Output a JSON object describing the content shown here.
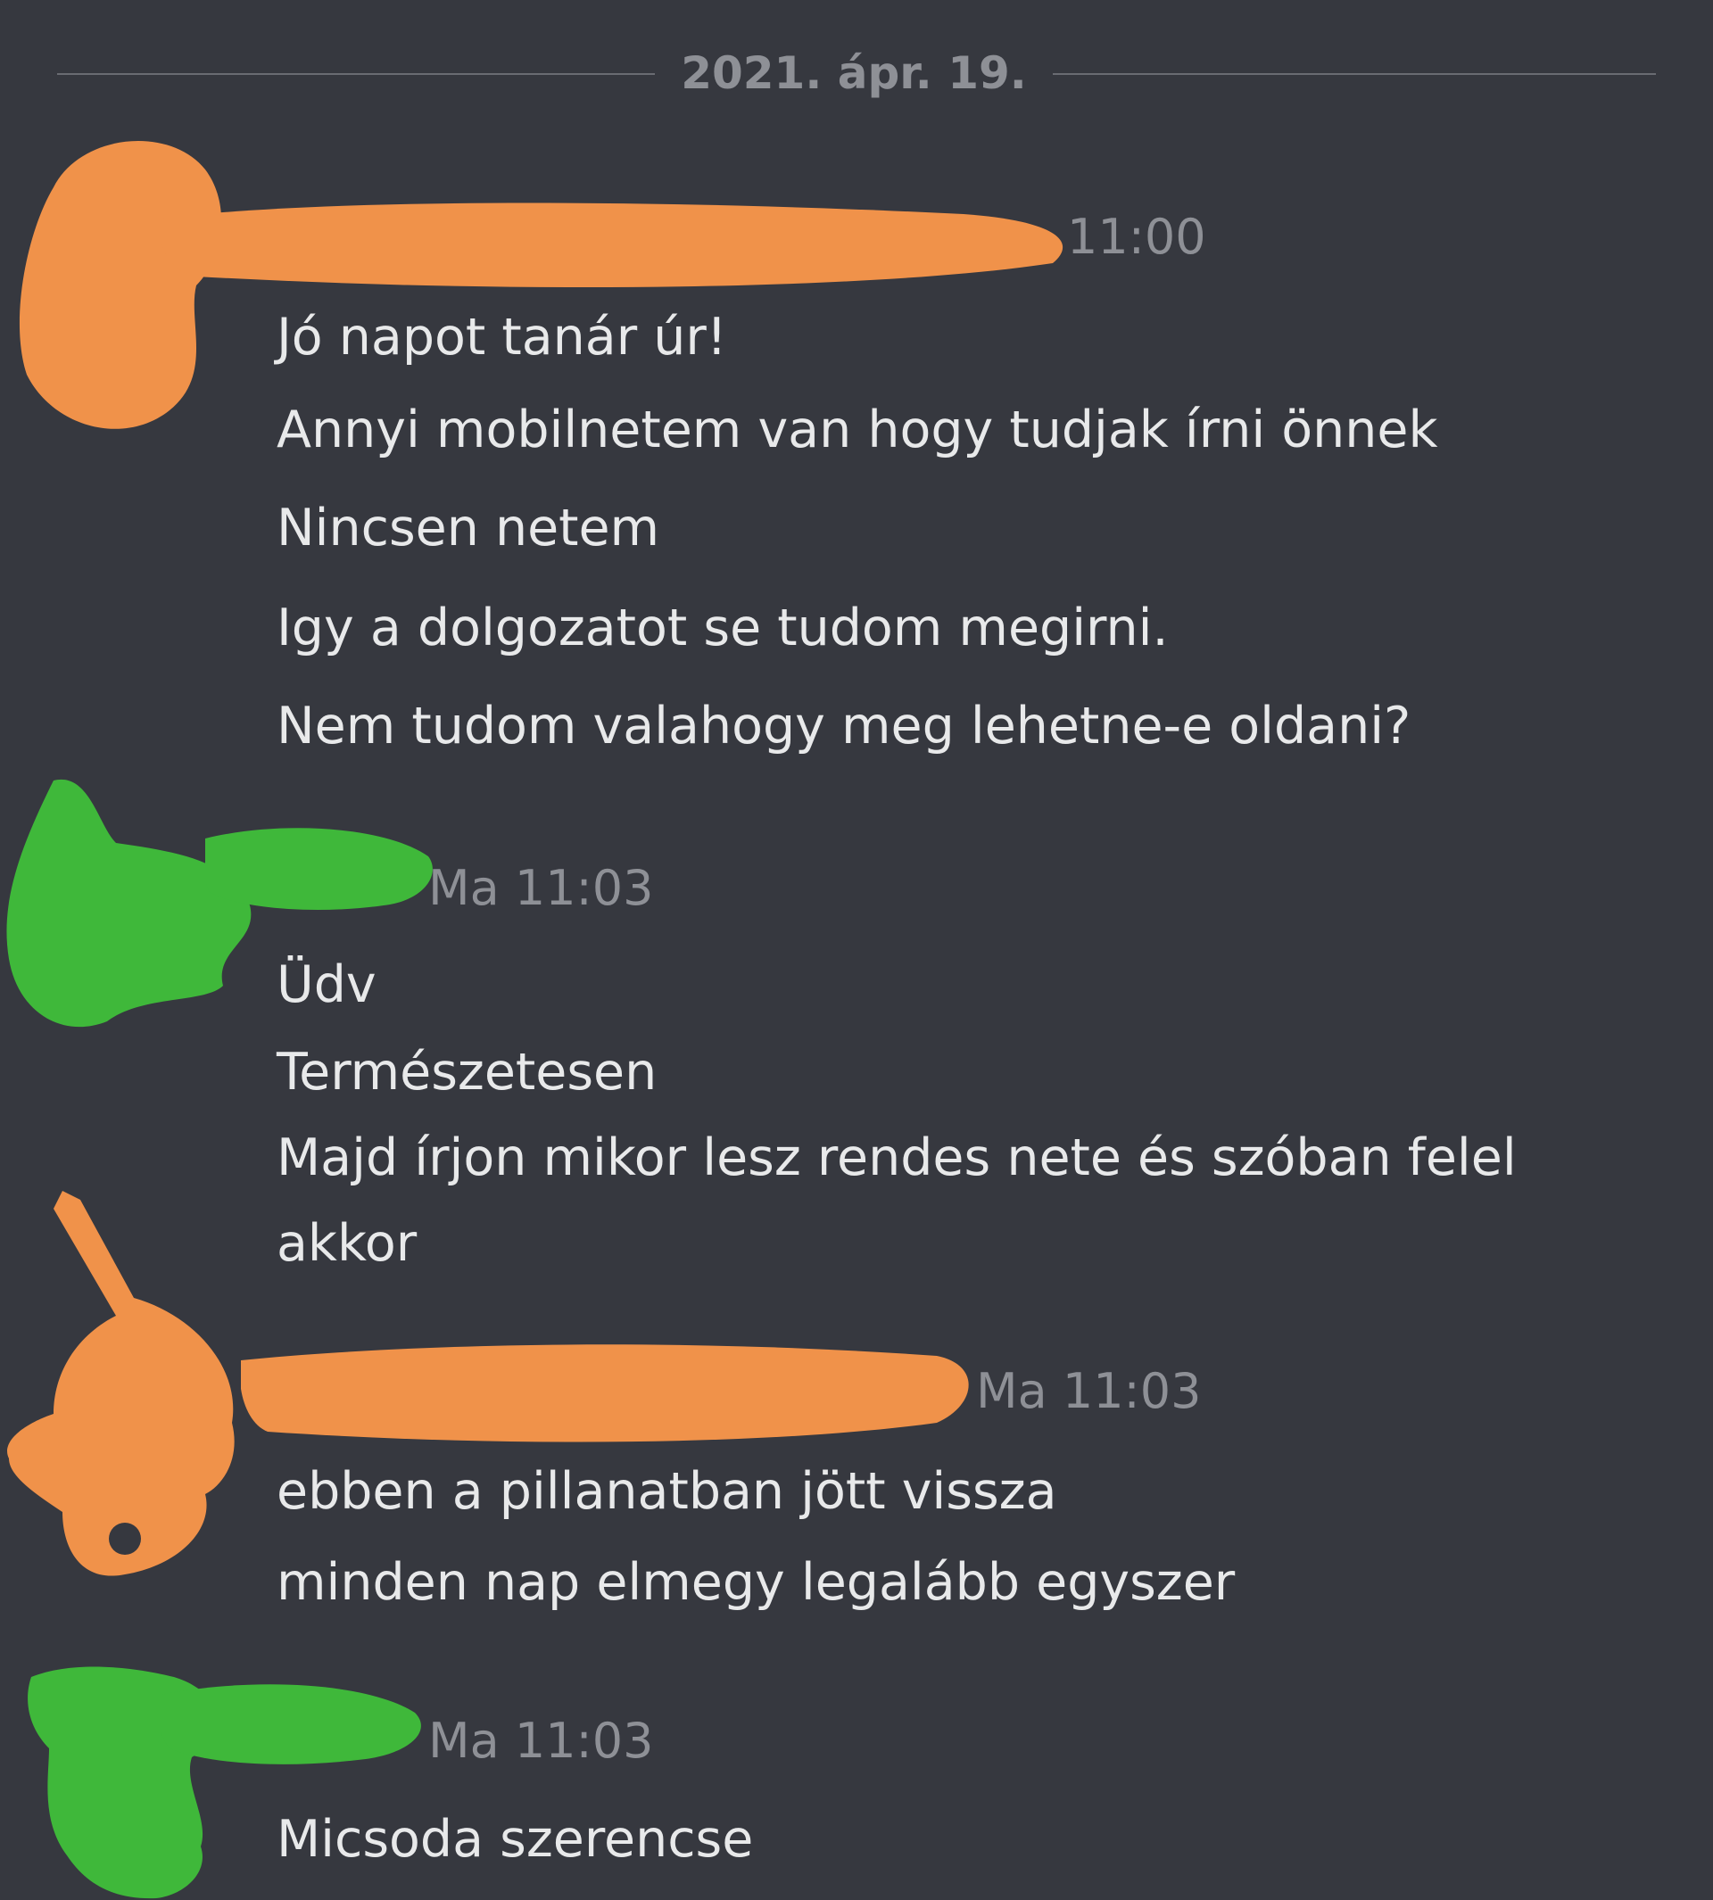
{
  "date_separator": "2021. ápr. 19.",
  "messages": [
    {
      "author_color": "#f0924a",
      "timestamp": "11:00",
      "lines": [
        "Jó napot tanár úr!",
        "Annyi mobilnetem van hogy tudjak írni önnek",
        "Nincsen netem",
        "Igy a dolgozatot se tudom megirni.",
        "Nem tudom valahogy meg lehetne-e oldani?"
      ]
    },
    {
      "author_color": "#3fb83a",
      "timestamp": "Ma 11:03",
      "lines": [
        "Üdv",
        "Természetesen",
        "Majd írjon mikor lesz rendes nete és szóban felel",
        "akkor"
      ]
    },
    {
      "author_color": "#f0924a",
      "timestamp": "Ma 11:03",
      "lines": [
        "ebben a pillanatban jött vissza",
        "minden nap elmegy legalább egyszer"
      ]
    },
    {
      "author_color": "#3fb83a",
      "timestamp": "Ma 11:03",
      "lines": [
        "Micsoda szerencse"
      ]
    }
  ]
}
